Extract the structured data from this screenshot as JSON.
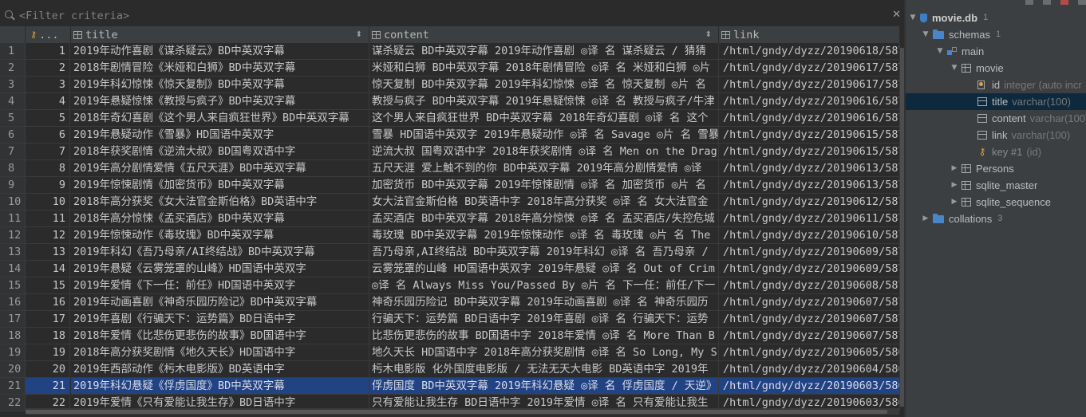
{
  "filter": {
    "placeholder": "<Filter criteria>"
  },
  "grid": {
    "columns": [
      {
        "name": "id_header",
        "label": "..."
      },
      {
        "name": "title",
        "label": "title"
      },
      {
        "name": "content",
        "label": "content"
      },
      {
        "name": "link",
        "label": "link"
      }
    ],
    "selected_row": 21,
    "rows": [
      {
        "n": "1",
        "id": "1",
        "title": "2019年动作喜剧《谋杀疑云》BD中英双字幕",
        "content": "谋杀疑云 BD中英双字幕 2019年动作喜剧 ◎译 名 谋杀疑云 / 猜猜",
        "link": "/html/gndy/dyzz/20190618/587"
      },
      {
        "n": "2",
        "id": "2",
        "title": "2018年剧情冒险《米娅和白狮》BD中英双字幕",
        "content": "米娅和白狮 BD中英双字幕 2018年剧情冒险 ◎译 名 米娅和白狮 ◎片",
        "link": "/html/gndy/dyzz/20190617/587"
      },
      {
        "n": "3",
        "id": "3",
        "title": "2019年科幻惊悚《惊天复制》BD中英双字幕",
        "content": "惊天复制 BD中英双字幕 2019年科幻惊悚 ◎译 名 惊天复制 ◎片 名",
        "link": "/html/gndy/dyzz/20190617/587"
      },
      {
        "n": "4",
        "id": "4",
        "title": "2019年悬疑惊悚《教授与疯子》BD中英双字幕",
        "content": "教授与疯子 BD中英双字幕 2019年悬疑惊悚 ◎译 名 教授与疯子/牛津",
        "link": "/html/gndy/dyzz/20190616/587"
      },
      {
        "n": "5",
        "id": "5",
        "title": "2018年奇幻喜剧《这个男人来自疯狂世界》BD中英双字幕",
        "content": "这个男人来自疯狂世界 BD中英双字幕 2018年奇幻喜剧 ◎译 名 这个",
        "link": "/html/gndy/dyzz/20190616/587"
      },
      {
        "n": "6",
        "id": "6",
        "title": "2019年悬疑动作《雪暴》HD国语中英双字",
        "content": "雪暴 HD国语中英双字 2019年悬疑动作 ◎译 名 Savage ◎片 名 雪暴",
        "link": "/html/gndy/dyzz/20190615/587"
      },
      {
        "n": "7",
        "id": "7",
        "title": "2018年获奖剧情《逆流大叔》BD国粤双语中字",
        "content": "逆流大叔 国粤双语中字 2018年获奖剧情 ◎译 名 Men on the Drag",
        "link": "/html/gndy/dyzz/20190615/587"
      },
      {
        "n": "8",
        "id": "8",
        "title": "2019年高分剧情爱情《五尺天涯》BD中英双字幕",
        "content": "五尺天涯 爱上触不到的你 BD中英双字幕 2019年高分剧情爱情 ◎译",
        "link": "/html/gndy/dyzz/20190613/587"
      },
      {
        "n": "9",
        "id": "9",
        "title": "2019年惊悚剧情《加密货币》BD中英双字幕",
        "content": "加密货币 BD中英双字幕 2019年惊悚剧情 ◎译 名 加密货币 ◎片 名",
        "link": "/html/gndy/dyzz/20190613/587"
      },
      {
        "n": "10",
        "id": "10",
        "title": "2018年高分获奖《女大法官金斯伯格》BD英语中字",
        "content": "女大法官金斯伯格 BD英语中字 2018年高分获奖 ◎译 名 女大法官金",
        "link": "/html/gndy/dyzz/20190612/587"
      },
      {
        "n": "11",
        "id": "11",
        "title": "2018年高分惊悚《孟买酒店》BD中英双字幕",
        "content": "孟买酒店 BD中英双字幕 2018年高分惊悚 ◎译 名 孟买酒店/失控危城",
        "link": "/html/gndy/dyzz/20190611/587"
      },
      {
        "n": "12",
        "id": "12",
        "title": "2019年惊悚动作《毒玫瑰》BD中英双字幕",
        "content": "毒玫瑰 BD中英双字幕 2019年惊悚动作 ◎译 名 毒玫瑰 ◎片 名 The",
        "link": "/html/gndy/dyzz/20190610/587"
      },
      {
        "n": "13",
        "id": "13",
        "title": "2019年科幻《吾乃母亲/AI终结战》BD中英双字幕",
        "content": "吾乃母亲,AI终结战 BD中英双字幕 2019年科幻 ◎译 名 吾乃母亲 /",
        "link": "/html/gndy/dyzz/20190609/587"
      },
      {
        "n": "14",
        "id": "14",
        "title": "2019年悬疑《云雾笼罩的山峰》HD国语中英双字",
        "content": "云雾笼罩的山峰 HD国语中英双字 2019年悬疑 ◎译 名 Out of Crim",
        "link": "/html/gndy/dyzz/20190609/587"
      },
      {
        "n": "15",
        "id": "15",
        "title": "2019年爱情《下一任：前任》HD国语中英双字",
        "content": "◎译 名 Always Miss You/Passed By ◎片 名 下一任：前任/下一",
        "link": "/html/gndy/dyzz/20190608/587"
      },
      {
        "n": "16",
        "id": "16",
        "title": "2019年动画喜剧《神奇乐园历险记》BD中英双字幕",
        "content": "神奇乐园历险记 BD中英双字幕 2019年动画喜剧 ◎译 名 神奇乐园历",
        "link": "/html/gndy/dyzz/20190607/587"
      },
      {
        "n": "17",
        "id": "17",
        "title": "2019年喜剧《行骗天下：运势篇》BD日语中字",
        "content": "行骗天下：运势篇 BD日语中字 2019年喜剧 ◎译 名 行骗天下：运势",
        "link": "/html/gndy/dyzz/20190607/587"
      },
      {
        "n": "18",
        "id": "18",
        "title": "2018年爱情《比悲伤更悲伤的故事》BD国语中字",
        "content": "比悲伤更悲伤的故事 BD国语中字 2018年爱情 ◎译 名 More Than B",
        "link": "/html/gndy/dyzz/20190607/587"
      },
      {
        "n": "19",
        "id": "19",
        "title": "2018年高分获奖剧情《地久天长》HD国语中字",
        "content": "地久天长 HD国语中字 2018年高分获奖剧情 ◎译 名 So Long, My S",
        "link": "/html/gndy/dyzz/20190605/586"
      },
      {
        "n": "20",
        "id": "20",
        "title": "2019年西部动作《杇木电影版》BD英语中字",
        "content": "杇木电影版 化外国度电影版 / 无法无天大电影 BD英语中字 2019年",
        "link": "/html/gndy/dyzz/20190604/586"
      },
      {
        "n": "21",
        "id": "21",
        "title": "2019年科幻悬疑《俘虏国度》BD中英双字幕",
        "content": "俘虏国度 BD中英双字幕 2019年科幻悬疑 ◎译 名 俘虏国度 / 天逆》",
        "link": "/html/gndy/dyzz/20190603/586"
      },
      {
        "n": "22",
        "id": "22",
        "title": "2019年爱情《只有爱能让我生存》BD日语中字",
        "content": "只有爱能让我生存 BD日语中字 2019年爱情 ◎译 名 只有爱能让我生",
        "link": "/html/gndy/dyzz/20190603/586"
      }
    ]
  },
  "tree": {
    "db": {
      "name": "movie.db",
      "count": "1"
    },
    "schemas": {
      "name": "schemas",
      "count": "1"
    },
    "main": {
      "name": "main"
    },
    "movie": {
      "name": "movie"
    },
    "columns": [
      {
        "name": "id",
        "type": "integer (auto incr"
      },
      {
        "name": "title",
        "type": "varchar(100)"
      },
      {
        "name": "content",
        "type": "varchar(100)"
      },
      {
        "name": "link",
        "type": "varchar(100)"
      }
    ],
    "key": {
      "name": "key #1",
      "type": "(id)"
    },
    "tables": [
      {
        "name": "Persons"
      },
      {
        "name": "sqlite_master"
      },
      {
        "name": "sqlite_sequence"
      }
    ],
    "collations": {
      "name": "collations",
      "count": "3"
    }
  }
}
